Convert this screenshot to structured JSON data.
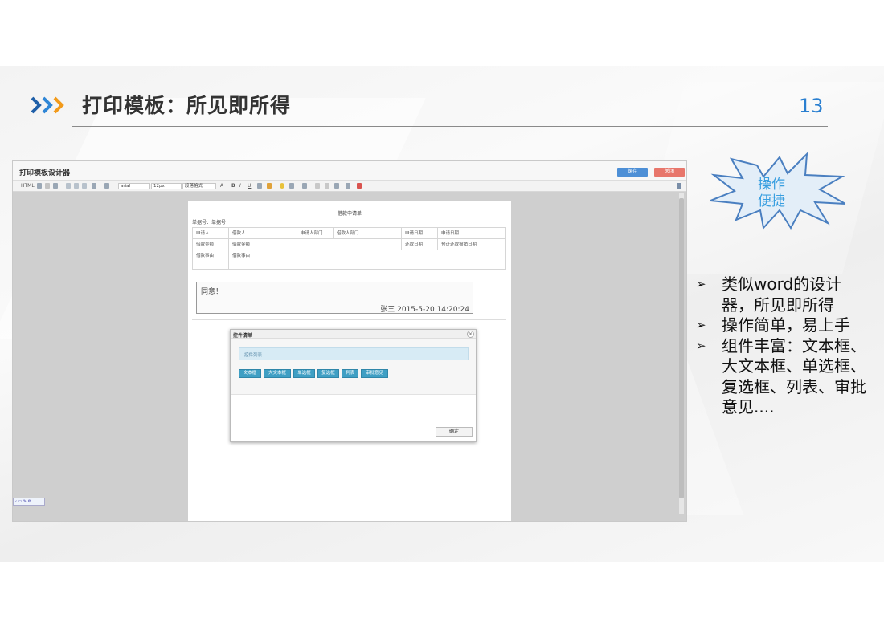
{
  "slide": {
    "title": "打印模板：所见即所得",
    "page_number": "13"
  },
  "app": {
    "title": "打印模板设计器",
    "save_label": "保存",
    "close_label": "关闭",
    "toolbar": {
      "source_label": "HTML",
      "font_family": "arial",
      "font_size": "12px",
      "paragraph_format": "段落格式"
    },
    "document": {
      "title": "借款申请单",
      "number_label": "单据号：单据号",
      "rows": [
        [
          "申请人",
          "借款人",
          "申请人部门",
          "借款人部门",
          "申请日期",
          "申请日期"
        ],
        [
          "借款金额",
          "借款金额",
          "",
          "",
          "还款日期",
          "预计还款报销日期"
        ],
        [
          "借款事由",
          "借款事由"
        ]
      ],
      "opinion_text": "同意！",
      "opinion_sign": "张三 2015-5-20 14:20:24"
    },
    "dialog": {
      "title": "控件清单",
      "list_label": "控件列表",
      "buttons": [
        "文本框",
        "大文本框",
        "单选框",
        "复选框",
        "列表",
        "审批意见"
      ],
      "ok_label": "确定"
    }
  },
  "badge": {
    "line1": "操作",
    "line2": "便捷"
  },
  "bullets": [
    "类似word的设计器，所见即所得",
    "操作简单，易上手",
    "组件丰富：文本框、大文本框、单选框、复选框、列表、审批意见...."
  ],
  "colors": {
    "title_text": "#333333",
    "accent_blue": "#2a7fd0",
    "badge_text": "#3a9fe0",
    "save_button": "#4d8fd6",
    "close_button": "#e8766b",
    "control_button": "#3f9fc4"
  },
  "icons": [
    "chevron-arrows-icon",
    "close-icon",
    "bullet-arrow-icon"
  ]
}
